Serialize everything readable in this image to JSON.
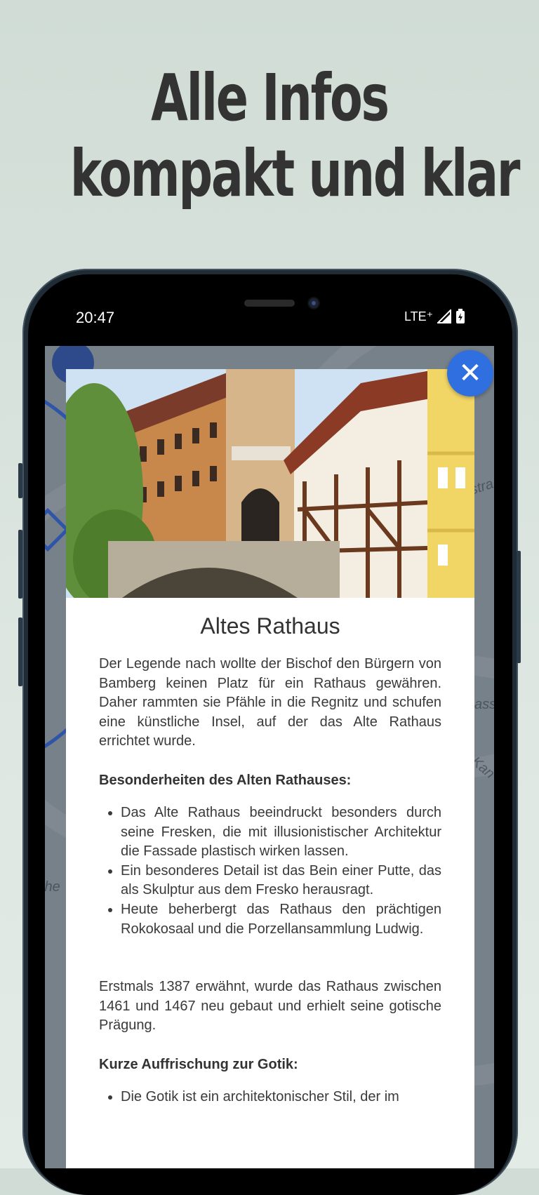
{
  "headline": {
    "line1": "Alle Infos",
    "line2": "kompakt und klar"
  },
  "status_bar": {
    "time": "20:47",
    "network": "LTE⁺"
  },
  "close_icon_glyph": "✕",
  "attraction": {
    "title": "Altes Rathaus",
    "intro": "Der Legende nach wollte der Bischof den Bürgern von Bamberg keinen Platz für ein Rathaus gewähren. Daher rammten sie Pfähle in die Regnitz und schufen eine künstliche Insel, auf der das Alte Rathaus errichtet wurde.",
    "features_heading": "Besonderheiten des Alten Rathauses:",
    "features": [
      "Das Alte Rathaus beeindruckt besonders durch seine Fresken, die mit illusionistischer Architektur die Fassade plastisch wirken lassen.",
      "Ein besonderes Detail ist das Bein einer Putte, das als Skulptur aus dem Fresko herausragt.",
      "Heute beherbergt das Rathaus den prächtigen Rokokosaal und die Porzellansammlung Ludwig."
    ],
    "history": "Erstmals 1387 erwähnt, wurde das Rathaus zwischen 1461 und 1467 neu gebaut und erhielt seine gotische Prägung.",
    "gothic_heading": "Kurze Auffrischung zur Gotik:",
    "gothic_items": [
      "Die Gotik ist ein architektonischer Stil, der im"
    ]
  },
  "map_labels": [
    "stra",
    "ass",
    "Kan",
    "the"
  ],
  "colors": {
    "accent": "#2f6fe0",
    "background": "#d0dcd5",
    "headline": "#333333",
    "route": "#2e55a8"
  },
  "icons": [
    "close-icon",
    "signal-icon",
    "battery-icon",
    "location-marker-icon"
  ]
}
